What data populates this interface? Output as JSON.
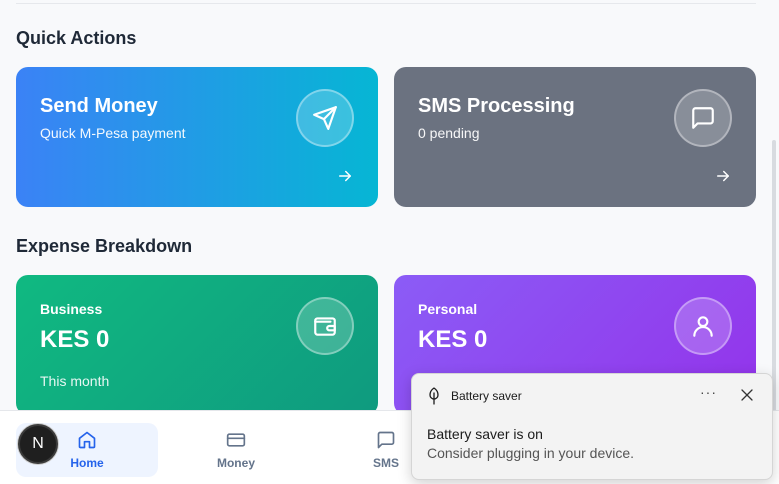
{
  "sections": {
    "quick_actions": "Quick Actions",
    "expense_breakdown": "Expense Breakdown"
  },
  "cards": {
    "send_money": {
      "title": "Send Money",
      "subtitle": "Quick M-Pesa payment",
      "icon": "send-icon",
      "color_from": "#3b82f6",
      "color_to": "#06b6d4"
    },
    "sms_processing": {
      "title": "SMS Processing",
      "subtitle": "0 pending",
      "icon": "message-icon",
      "color": "#6b7280"
    },
    "business": {
      "label": "Business",
      "amount": "KES 0",
      "period": "This month",
      "icon": "wallet-icon",
      "color_from": "#10b981",
      "color_to": "#0f9a7f"
    },
    "personal": {
      "label": "Personal",
      "amount": "KES 0",
      "icon": "user-icon",
      "color_from": "#8b5cf6",
      "color_to": "#9333ea"
    }
  },
  "nav": {
    "items": [
      {
        "label": "Home",
        "icon": "home-icon",
        "active": true
      },
      {
        "label": "Money",
        "icon": "card-icon",
        "active": false
      },
      {
        "label": "SMS",
        "icon": "chat-icon",
        "active": false
      }
    ]
  },
  "avatar": {
    "letter": "N"
  },
  "toast": {
    "app": "Battery saver",
    "more": "···",
    "title": "Battery saver is on",
    "body": "Consider plugging in your device.",
    "icon": "battery-saver-icon"
  }
}
